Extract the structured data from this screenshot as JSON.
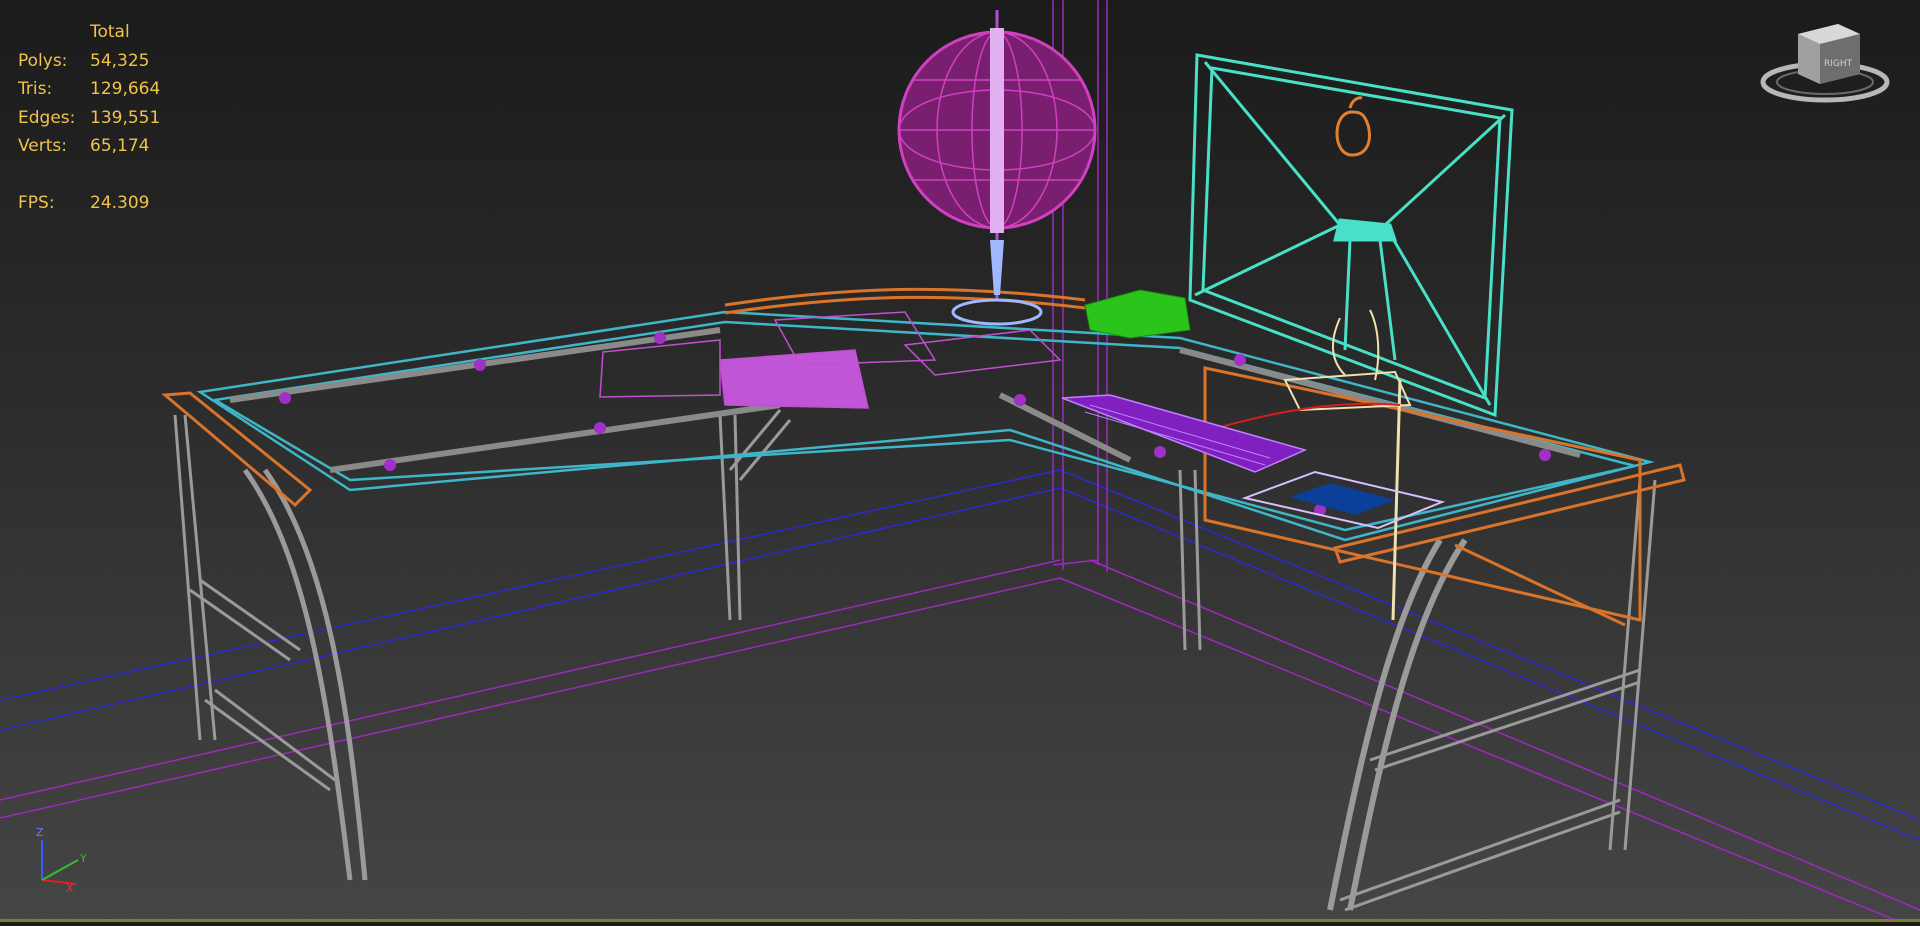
{
  "stats": {
    "header": "Total",
    "rows": [
      {
        "label": "Polys:",
        "value": "54,325"
      },
      {
        "label": "Tris:",
        "value": "129,664"
      },
      {
        "label": "Edges:",
        "value": "139,551"
      },
      {
        "label": "Verts:",
        "value": "65,174"
      }
    ],
    "fps_label": "FPS:",
    "fps_value": "24.309"
  },
  "viewcube": {
    "face_label": "RIGHT"
  },
  "axis_tripod": {
    "z_label": "Z",
    "x_label": "X",
    "y_label": "Y"
  },
  "colors": {
    "stats_text": "#f0c34a",
    "desk_frame_orange": "#d9742a",
    "glass_cyan": "#3fb6c8",
    "legs_gray": "#9a9a9a",
    "globe_magenta": "#c040b0",
    "monitor_cyan": "#49e0c8",
    "keyboard_purple": "#8020c0",
    "phone_green": "#2ac41a",
    "floor_blue": "#2a2ad0",
    "wall_purple": "#a028c0"
  },
  "icons": [
    "viewcube-icon",
    "axis-tripod-icon",
    "apple-logo-icon"
  ]
}
